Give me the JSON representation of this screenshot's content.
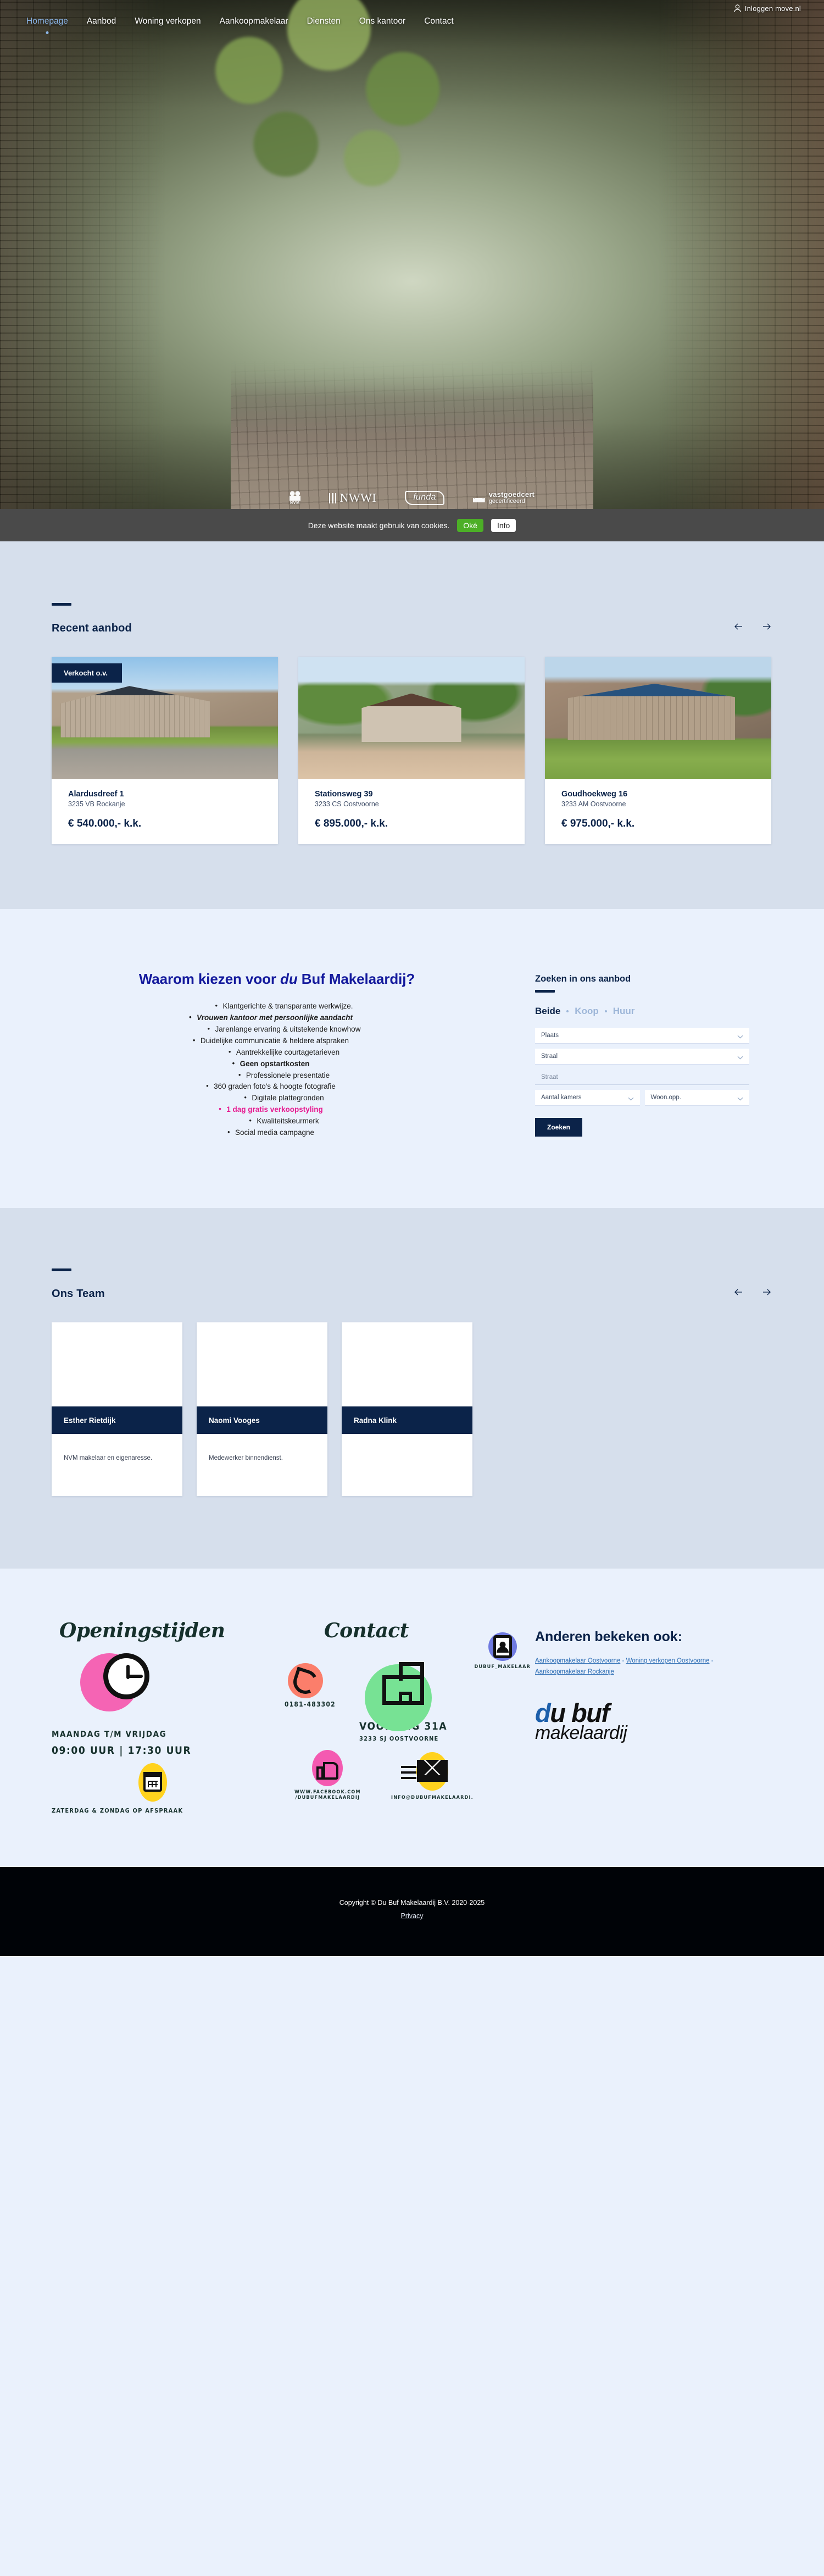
{
  "nav": {
    "login_label": "Inloggen move.nl",
    "items": [
      {
        "label": "Homepage",
        "active": true
      },
      {
        "label": "Aanbod",
        "active": false
      },
      {
        "label": "Woning verkopen",
        "active": false
      },
      {
        "label": "Aankoopmakelaar",
        "active": false
      },
      {
        "label": "Diensten",
        "active": false
      },
      {
        "label": "Ons kantoor",
        "active": false
      },
      {
        "label": "Contact",
        "active": false
      }
    ]
  },
  "certifications": [
    {
      "name": "NVM",
      "label": "NVM"
    },
    {
      "name": "NWWI",
      "label": "NWWI"
    },
    {
      "name": "funda",
      "label": "funda"
    },
    {
      "name": "vastgoedcert",
      "label": "vastgoedcert",
      "sub": "gecertificeerd"
    }
  ],
  "cookie": {
    "message": "Deze website maakt gebruik van cookies.",
    "accept_label": "Oké",
    "info_label": "Info"
  },
  "aanbod": {
    "title": "Recent aanbod",
    "prev_label": "Vorige",
    "next_label": "Volgende",
    "cards": [
      {
        "badge": "Verkocht o.v.",
        "address": "Alardusdreef 1",
        "zip": "3235 VB Rockanje",
        "price": "€ 540.000,- k.k."
      },
      {
        "badge": "",
        "address": "Stationsweg 39",
        "zip": "3233 CS Oostvoorne",
        "price": "€ 895.000,- k.k."
      },
      {
        "badge": "",
        "address": "Goudhoekweg 16",
        "zip": "3233 AM Oostvoorne",
        "price": "€ 975.000,- k.k."
      }
    ]
  },
  "waarom": {
    "title_pre": "Waarom kiezen voor ",
    "title_em": "du",
    "title_post": " Buf Makelaardij?",
    "bullets": [
      {
        "text": "Klantgerichte & transparante werkwijze.",
        "style": "normal"
      },
      {
        "text": "Vrouwen kantoor met persoonlijke aandacht",
        "style": "bold-italic"
      },
      {
        "text": "Jarenlange ervaring & uitstekende knowhow",
        "style": "normal"
      },
      {
        "text": "Duidelijke communicatie & heldere afspraken",
        "style": "normal"
      },
      {
        "text": "Aantrekkelijke courtagetarieven",
        "style": "normal"
      },
      {
        "text": "Geen opstartkosten",
        "style": "bold"
      },
      {
        "text": "Professionele presentatie",
        "style": "normal"
      },
      {
        "text": "360 graden foto's & hoogte fotografie",
        "style": "normal"
      },
      {
        "text": "Digitale plattegronden",
        "style": "normal"
      },
      {
        "text": "1 dag gratis verkoopstyling",
        "style": "pink"
      },
      {
        "text": "Kwaliteitskeurmerk",
        "style": "normal"
      },
      {
        "text": "Social media campagne",
        "style": "normal"
      }
    ]
  },
  "zoeken": {
    "title": "Zoeken in ons aanbod",
    "tabs": [
      {
        "label": "Beide",
        "active": true
      },
      {
        "label": "Koop",
        "active": false
      },
      {
        "label": "Huur",
        "active": false
      }
    ],
    "fields": {
      "plaats": "Plaats",
      "straal": "Straal",
      "straat": "Straat",
      "aantal_kamers": "Aantal kamers",
      "woon_opp": "Woon.opp."
    },
    "submit_label": "Zoeken"
  },
  "team": {
    "title": "Ons Team",
    "prev_label": "Vorige",
    "next_label": "Volgende",
    "members": [
      {
        "name": "Esther Rietdijk",
        "role": "NVM makelaar en eigenaresse."
      },
      {
        "name": "Naomi Vooges",
        "role": "Medewerker binnendienst."
      },
      {
        "name": "Radna Klink",
        "role": ""
      }
    ]
  },
  "openingstijden": {
    "heading": "Openingstijden",
    "days": "MAANDAG T/M VRIJDAG",
    "hours": "09:00 UUR | 17:30 UUR",
    "weekend": "ZATERDAG & ZONDAG OP AFSPRAAK"
  },
  "contact": {
    "heading": "Contact",
    "phone": "0181-483302",
    "address_line1": "VOORWEG 31A",
    "address_line2": "3233 SJ OOSTVOORNE",
    "instagram": "DUBUF_MAKELAAR",
    "facebook_line1": "WWW.FACEBOOK.COM",
    "facebook_line2": "/DUBUFMAKELAARDIJ",
    "email": "INFO@DUBUFMAKELAARDI."
  },
  "anderen": {
    "heading": "Anderen bekeken ook:",
    "links": [
      "Aankoopmakelaar Oostvoorne",
      "Woning verkopen Oostvoorne",
      "Aankoopmakelaar Rockanje"
    ],
    "separator": " - ",
    "logo_line1_accent": "d",
    "logo_line1_rest": "u buf",
    "logo_line2": "makelaardij"
  },
  "bottom": {
    "copyright": "Copyright © Du Buf Makelaardij B.V. 2020-2025",
    "privacy_label": "Privacy"
  },
  "colors": {
    "navy": "#0b2349",
    "section_light": "#eaf1fc",
    "section_mid": "#d6dfec",
    "accent_blue": "#13199c",
    "pink": "#e6188f",
    "link_blue": "#2f6fb5",
    "cookie_green": "#4caf26"
  }
}
